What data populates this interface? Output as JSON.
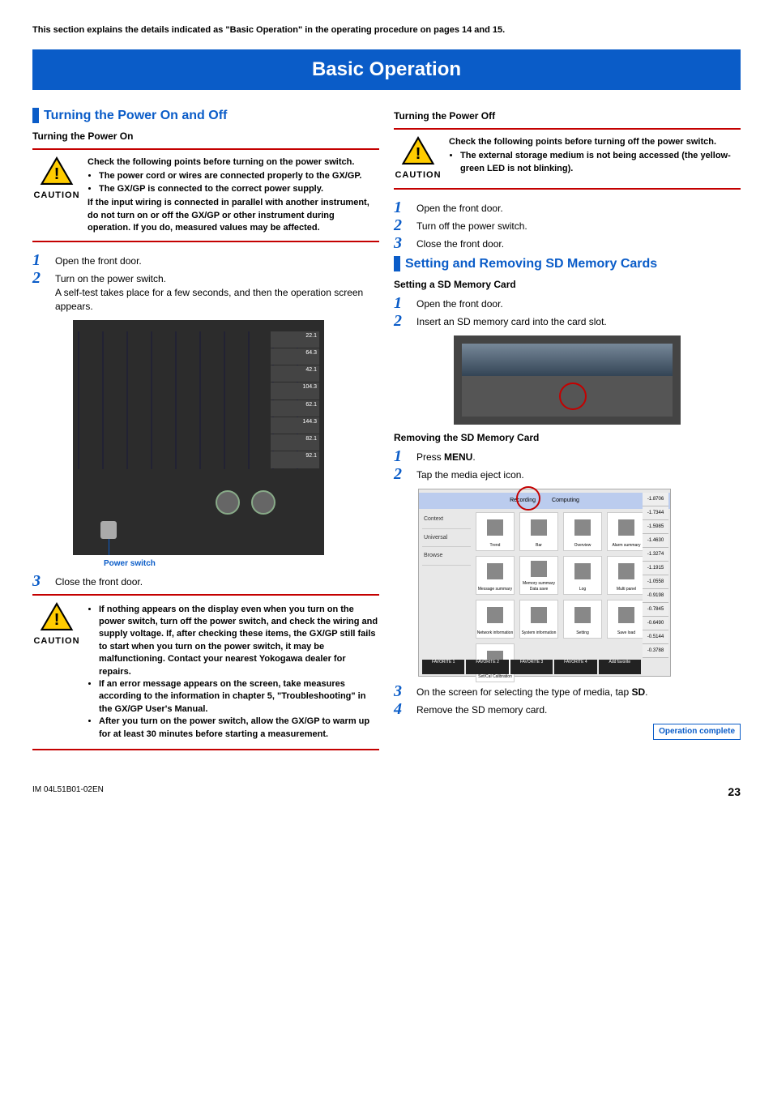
{
  "intro": "This section explains the details indicated as \"Basic Operation\" in the operating procedure on pages 14 and 15.",
  "title": "Basic Operation",
  "left": {
    "h_power": "Turning the Power On and Off",
    "h_on": "Turning the Power On",
    "caution_label": "CAUTION",
    "c1_lead": "Check the following points before turning on the power switch.",
    "c1_b1": "The power cord or wires are connected properly to the GX/GP.",
    "c1_b2": "The GX/GP is connected to the correct power supply.",
    "c1_tail": "If the input wiring is connected in parallel with another instrument, do not turn on or off the GX/GP or other instrument during operation. If you do, measured values may be affected.",
    "s1": "Open the front door.",
    "s2a": "Turn on the power switch.",
    "s2b": "A self-test takes place for a few seconds, and then the operation screen appears.",
    "ps_label": "Power switch",
    "trend_vals": [
      "22.1",
      "64.3",
      "42.1",
      "104.3",
      "62.1",
      "144.3",
      "82.1",
      "92.1"
    ],
    "s3": "Close the front door.",
    "c2_b1": "If nothing appears on the display even when you turn on the power switch, turn off the power switch, and check the wiring and supply voltage. If, after checking these items, the GX/GP still fails to start when you turn on the power switch, it may be malfunctioning. Contact your nearest Yokogawa dealer for repairs.",
    "c2_b2": "If an error message appears on the screen, take measures according to the information in chapter 5, \"Troubleshooting\" in the GX/GP User's Manual.",
    "c2_b3": "After you turn on the power switch, allow the GX/GP to warm up for at least 30 minutes before starting a measurement."
  },
  "right": {
    "h_off": "Turning the Power Off",
    "caution_label": "CAUTION",
    "c3_lead": "Check the following points before turning off the power switch.",
    "c3_b1": "The external storage medium is not being accessed (the yellow-green LED is not blinking).",
    "off_s1": "Open the front door.",
    "off_s2": "Turn off the power switch.",
    "off_s3": "Close the front door.",
    "h_sd": "Setting and Removing SD Memory Cards",
    "h_set": "Setting a SD Memory Card",
    "set_s1": "Open the front door.",
    "set_s2": "Insert an SD memory card into the card slot.",
    "h_rem": "Removing the SD Memory Card",
    "rem_s1_a": "Press ",
    "rem_s1_b": "MENU",
    "rem_s1_c": ".",
    "rem_s2": "Tap the media eject icon.",
    "menu_top": [
      "Recording",
      "Computing"
    ],
    "menu_side": [
      "Context",
      "Universal",
      "Browse"
    ],
    "menu_cells": [
      "Trend",
      "Bar",
      "Overview",
      "Alarm summary",
      "Message summary",
      "Memory summary Data save",
      "Log",
      "Multi panel",
      "Network information",
      "System information",
      "Setting",
      "Save load",
      "Set/Cal Calibration"
    ],
    "menu_right": [
      "-1.8706",
      "-1.7344",
      "-1.5985",
      "-1.4630",
      "-1.3274",
      "-1.1915",
      "-1.0558",
      "-0.9198",
      "-0.7845",
      "-0.6490",
      "-0.5144",
      "-0.3788"
    ],
    "favs": [
      "FAVORITE 1",
      "FAVORITE 2",
      "FAVORITE 3",
      "FAVORITE 4",
      "Add favorite"
    ],
    "rem_s3_a": "On the screen for selecting the type of media, tap ",
    "rem_s3_b": "SD",
    "rem_s3_c": ".",
    "rem_s4": "Remove the SD memory card.",
    "complete": "Operation complete"
  },
  "footer": {
    "doc": "IM 04L51B01-02EN",
    "page": "23"
  }
}
